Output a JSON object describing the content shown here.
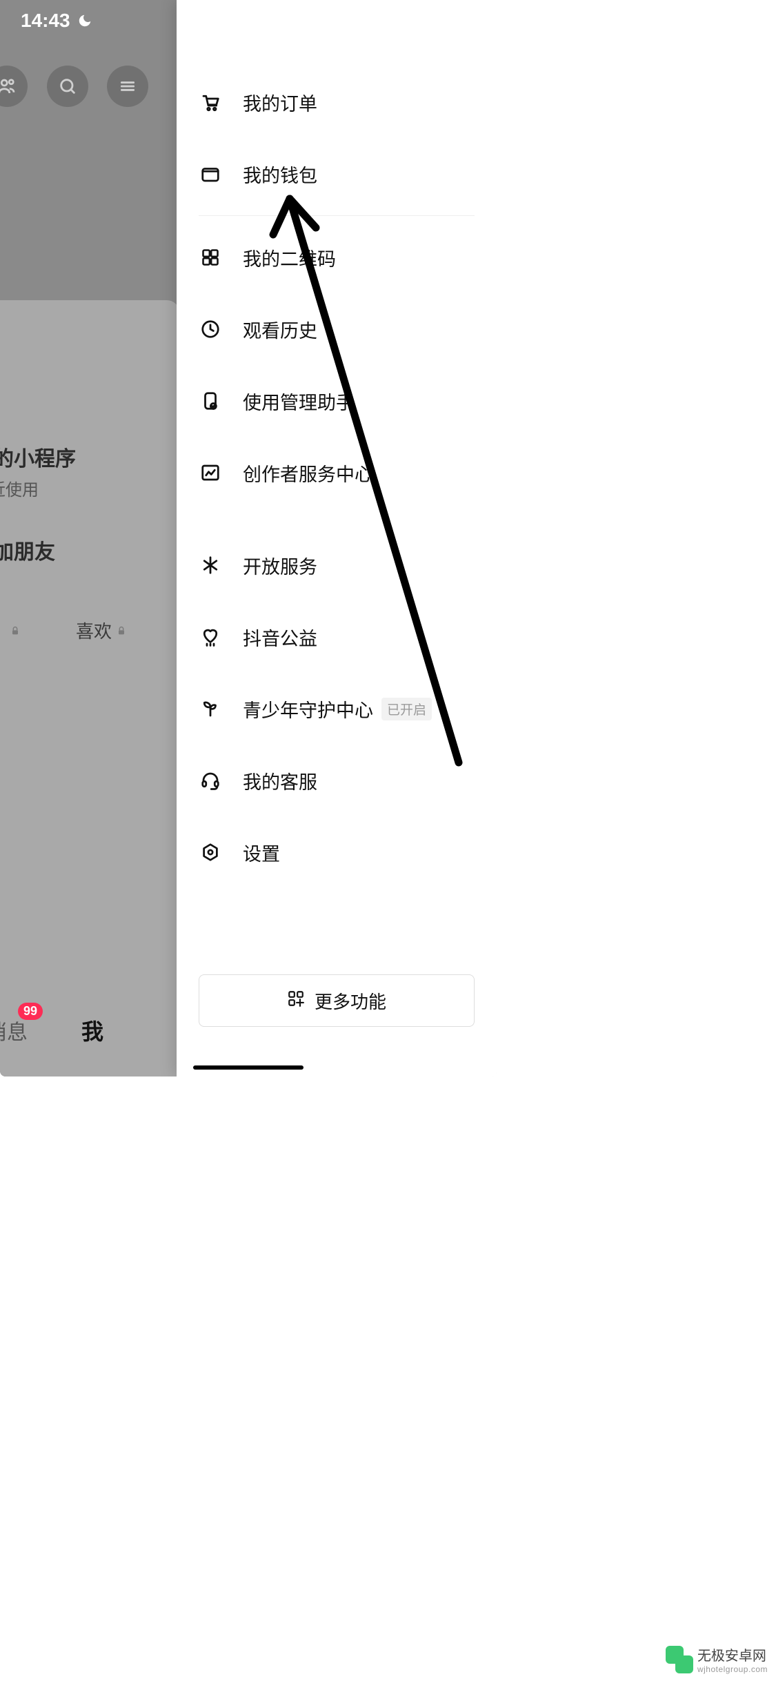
{
  "status": {
    "time": "14:43"
  },
  "background": {
    "mini_programs_title": "我的小程序",
    "recent_use": "最近使用",
    "add_friend": "添加朋友",
    "like_label": "喜欢",
    "message_label": "消息",
    "message_badge": "99",
    "me_label": "我"
  },
  "drawer": {
    "items": [
      {
        "label": "我的订单",
        "icon": "cart"
      },
      {
        "label": "我的钱包",
        "icon": "wallet"
      }
    ],
    "items2": [
      {
        "label": "我的二维码",
        "icon": "qrcode"
      },
      {
        "label": "观看历史",
        "icon": "clock"
      },
      {
        "label": "使用管理助手",
        "icon": "phone-check"
      },
      {
        "label": "创作者服务中心",
        "icon": "analytics"
      }
    ],
    "items3": [
      {
        "label": "开放服务",
        "icon": "spark"
      },
      {
        "label": "抖音公益",
        "icon": "heart-rain"
      },
      {
        "label": "青少年守护中心",
        "icon": "sprout",
        "tag": "已开启"
      },
      {
        "label": "我的客服",
        "icon": "headset"
      },
      {
        "label": "设置",
        "icon": "hex-gear"
      }
    ],
    "more_button": "更多功能"
  },
  "watermark": {
    "title": "无极安卓网",
    "url": "wjhotelgroup.com"
  }
}
